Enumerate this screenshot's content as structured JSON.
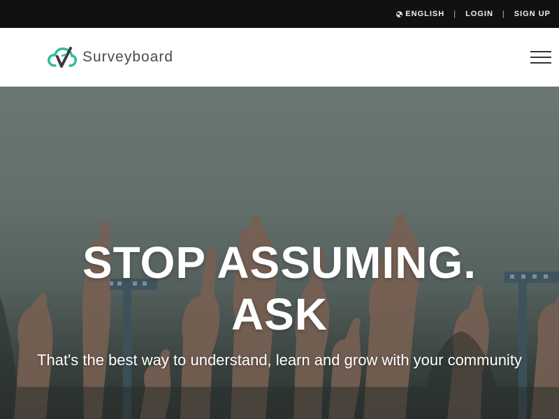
{
  "topbar": {
    "language_label": "ENGLISH",
    "login_label": "LOGIN",
    "signup_label": "SIGN UP",
    "separator": "|"
  },
  "navbar": {
    "brand_name": "Surveyboard",
    "logo_icon": "cloud-check-logo",
    "menu_icon": "hamburger-icon"
  },
  "hero": {
    "title_line1": "STOP ASSUMING.",
    "title_line2": "ASK",
    "subtitle": "That's the best way to understand, learn and grow with your community"
  },
  "colors": {
    "topbar_bg": "#111111",
    "brand_accent": "#2ebd9b",
    "hero_text": "#ffffff"
  }
}
